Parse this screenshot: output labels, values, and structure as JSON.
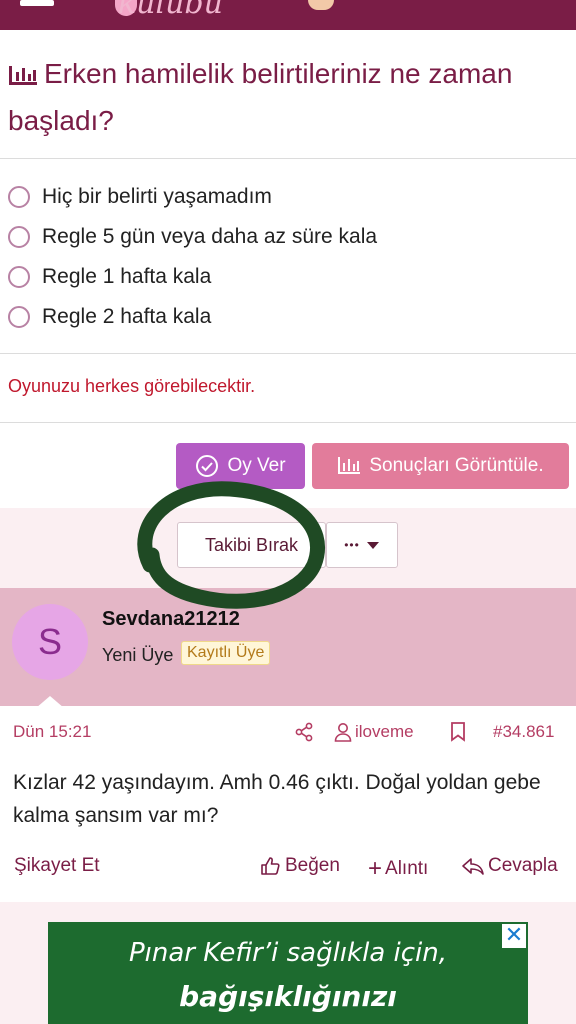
{
  "header": {
    "logo_text": "kulübü",
    "brand_color": "#7a1d46"
  },
  "poll": {
    "question": "Erken hamilelik belirtileriniz ne zaman başladı?",
    "options": [
      "Hiç bir belirti yaşamadım",
      "Regle 5 gün veya daha az süre kala",
      "Regle 1 hafta kala",
      "Regle 2 hafta kala"
    ],
    "public_note": "Oyunuzu herkes görebilecektir.",
    "vote_label": "Oy Ver",
    "results_label": "Sonuçları Görüntüle."
  },
  "thread": {
    "unfollow_label": "Takibi Bırak",
    "more_label": "•••"
  },
  "post": {
    "author": {
      "initial": "S",
      "name": "Sevdana21212",
      "role": "Yeni Üye",
      "badge": "Kayıtlı Üye"
    },
    "time": "Dün 15:21",
    "share_user": "iloveme",
    "post_number": "#34.861",
    "body": "Kızlar 42 yaşındayım. Amh 0.46 çıktı. Doğal yoldan gebe kalma şansım var mı?",
    "actions": {
      "report": "Şikayet Et",
      "like": "Beğen",
      "quote": "Alıntı",
      "reply": "Cevapla"
    }
  },
  "ad": {
    "line1": "Pınar Kefir’i sağlıkla için,",
    "line2": "bağışıklığınızı",
    "close": "✕"
  }
}
